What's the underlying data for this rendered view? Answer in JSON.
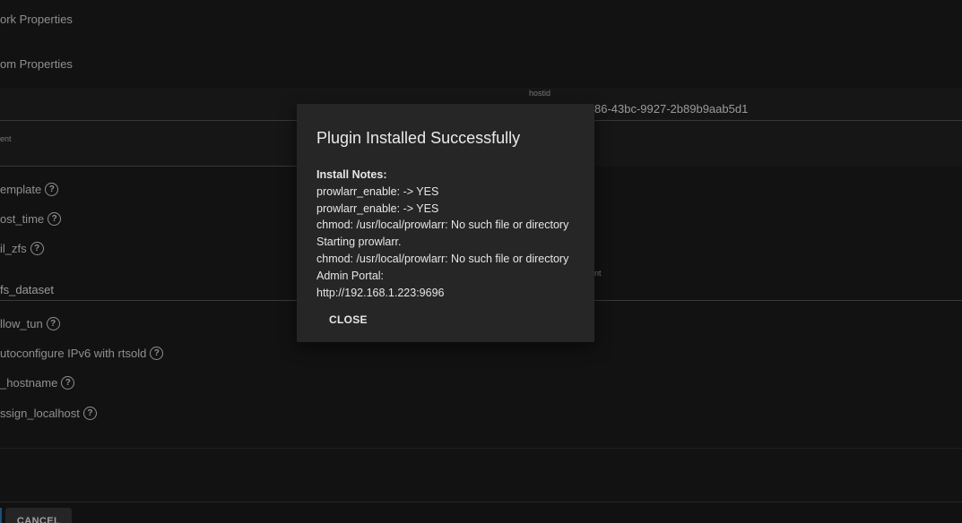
{
  "background": {
    "sections": {
      "network_properties": "ork Properties",
      "custom_properties": "om Properties"
    },
    "hostid": {
      "label": "hostid",
      "value": "86-43bc-9927-2b89b9aab5d1"
    },
    "comment_label": "ent",
    "right_comment_label": "nt",
    "fields": [
      {
        "label": "emplate",
        "has_help": true
      },
      {
        "label": "ost_time",
        "has_help": true
      },
      {
        "label": "il_zfs",
        "has_help": true
      },
      {
        "label": "fs_dataset",
        "has_help": false
      },
      {
        "label": "llow_tun",
        "has_help": true
      },
      {
        "label": "utoconfigure IPv6 with rtsold",
        "has_help": true
      },
      {
        "label": "_hostname",
        "has_help": true
      },
      {
        "label": "ssign_localhost",
        "has_help": true
      }
    ],
    "help_glyph": "?",
    "cancel_label": "CANCEL"
  },
  "dialog": {
    "title": "Plugin Installed Successfully",
    "notes_heading": "Install Notes:",
    "lines": [
      "prowlarr_enable: -> YES",
      "prowlarr_enable: -> YES",
      "chmod: /usr/local/prowlarr: No such file or directory",
      "Starting prowlarr.",
      "chmod: /usr/local/prowlarr: No such file or directory",
      "Admin Portal:",
      "http://192.168.1.223:9696"
    ],
    "close_label": "CLOSE"
  },
  "colors": {
    "page_bg": "#161616",
    "dialog_bg": "#262626",
    "accent": "#1f5f8f"
  }
}
